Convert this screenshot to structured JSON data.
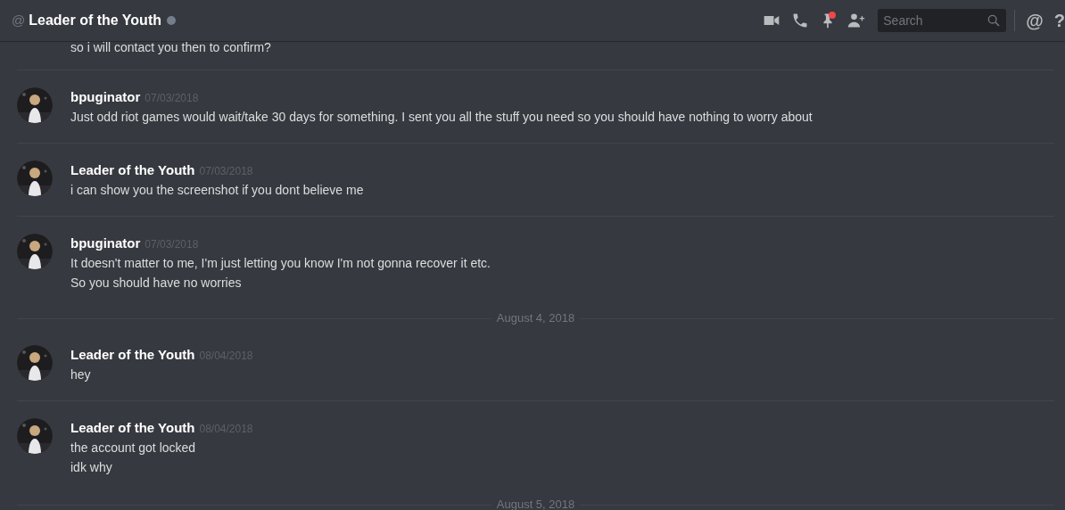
{
  "header": {
    "at_sign": "@",
    "title": "Leader of the Youth",
    "online": false,
    "pins_unread": true,
    "search": {
      "placeholder": "Search"
    },
    "mention_sign": "@",
    "help_sign": "?"
  },
  "entries": [
    {
      "kind": "message",
      "lines": [
        "so i will contact you then to confirm?"
      ]
    },
    {
      "kind": "message",
      "author": "bpuginator",
      "timestamp": "07/03/2018",
      "lines": [
        "Just odd riot games would wait/take 30 days for something. I sent you all the stuff you need so you should have nothing to worry about"
      ]
    },
    {
      "kind": "message",
      "author": "Leader of the Youth",
      "timestamp": "07/03/2018",
      "lines": [
        "i can show you the screenshot if you dont believe me"
      ]
    },
    {
      "kind": "message",
      "author": "bpuginator",
      "timestamp": "07/03/2018",
      "lines": [
        "It doesn't matter to me, I'm just letting you know I'm not gonna recover it etc.",
        "So you should have no worries"
      ]
    },
    {
      "kind": "date",
      "label": "August 4, 2018"
    },
    {
      "kind": "message",
      "author": "Leader of the Youth",
      "timestamp": "08/04/2018",
      "lines": [
        "hey"
      ]
    },
    {
      "kind": "message",
      "author": "Leader of the Youth",
      "timestamp": "08/04/2018",
      "lines": [
        "the account got locked",
        "idk why"
      ]
    },
    {
      "kind": "date",
      "label": "August 5, 2018"
    }
  ]
}
